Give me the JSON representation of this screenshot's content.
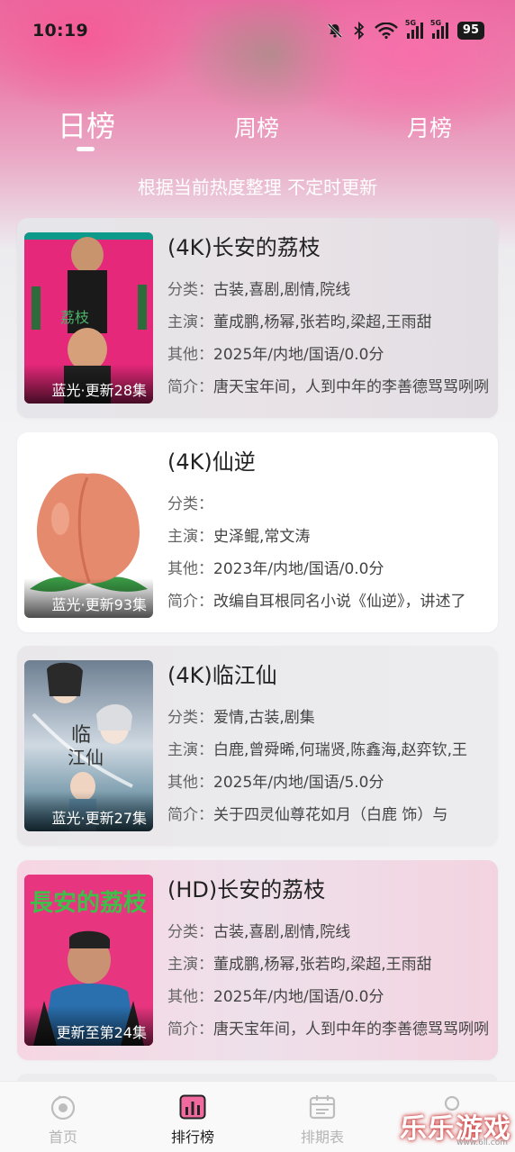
{
  "status_bar": {
    "time": "10:19",
    "battery": "95",
    "signal_label_1": "5G",
    "signal_label_2": "5G"
  },
  "tabs": [
    {
      "label": "日榜",
      "active": true
    },
    {
      "label": "周榜",
      "active": false
    },
    {
      "label": "月榜",
      "active": false
    }
  ],
  "subtitle": "根据当前热度整理 不定时更新",
  "labels": {
    "category": "分类：",
    "cast": "主演：",
    "other": "其他：",
    "intro": "简介："
  },
  "items": [
    {
      "title": "(4K)长安的荔枝",
      "category": "古装,喜剧,剧情,院线",
      "cast": "董成鹏,杨幂,张若昀,梁超,王雨甜",
      "other": "2025年/内地/国语/0.0分",
      "intro": "唐天宝年间，人到中年的李善德骂骂咧咧",
      "badge": "蓝光·更新28集"
    },
    {
      "title": "(4K)仙逆",
      "category": "",
      "cast": "史泽鲲,常文涛",
      "other": "2023年/内地/国语/0.0分",
      "intro": "改编自耳根同名小说《仙逆》，讲述了",
      "badge": "蓝光·更新93集"
    },
    {
      "title": "(4K)临江仙",
      "category": "爱情,古装,剧集",
      "cast": "白鹿,曾舜晞,何瑞贤,陈鑫海,赵弈钦,王",
      "other": "2025年/内地/国语/5.0分",
      "intro": "关于四灵仙尊花如月（白鹿 饰）与",
      "badge": "蓝光·更新27集"
    },
    {
      "title": "(HD)长安的荔枝",
      "category": "古装,喜剧,剧情,院线",
      "cast": "董成鹏,杨幂,张若昀,梁超,王雨甜",
      "other": "2025年/内地/国语/0.0分",
      "intro": "唐天宝年间，人到中年的李善德骂骂咧咧",
      "badge": "更新至第24集"
    }
  ],
  "bottom_nav": [
    {
      "label": "首页",
      "icon": "home-icon",
      "active": false
    },
    {
      "label": "排行榜",
      "icon": "ranking-icon",
      "active": true
    },
    {
      "label": "排期表",
      "icon": "schedule-icon",
      "active": false
    },
    {
      "label": "",
      "icon": "profile-icon",
      "active": false
    }
  ],
  "watermark": {
    "text": "乐乐游戏",
    "url": "www.6ll.com"
  },
  "colors": {
    "accent_pink": "#e96aa0",
    "active_tab": "#ffffff",
    "inactive_nav": "#b5b5b5"
  }
}
